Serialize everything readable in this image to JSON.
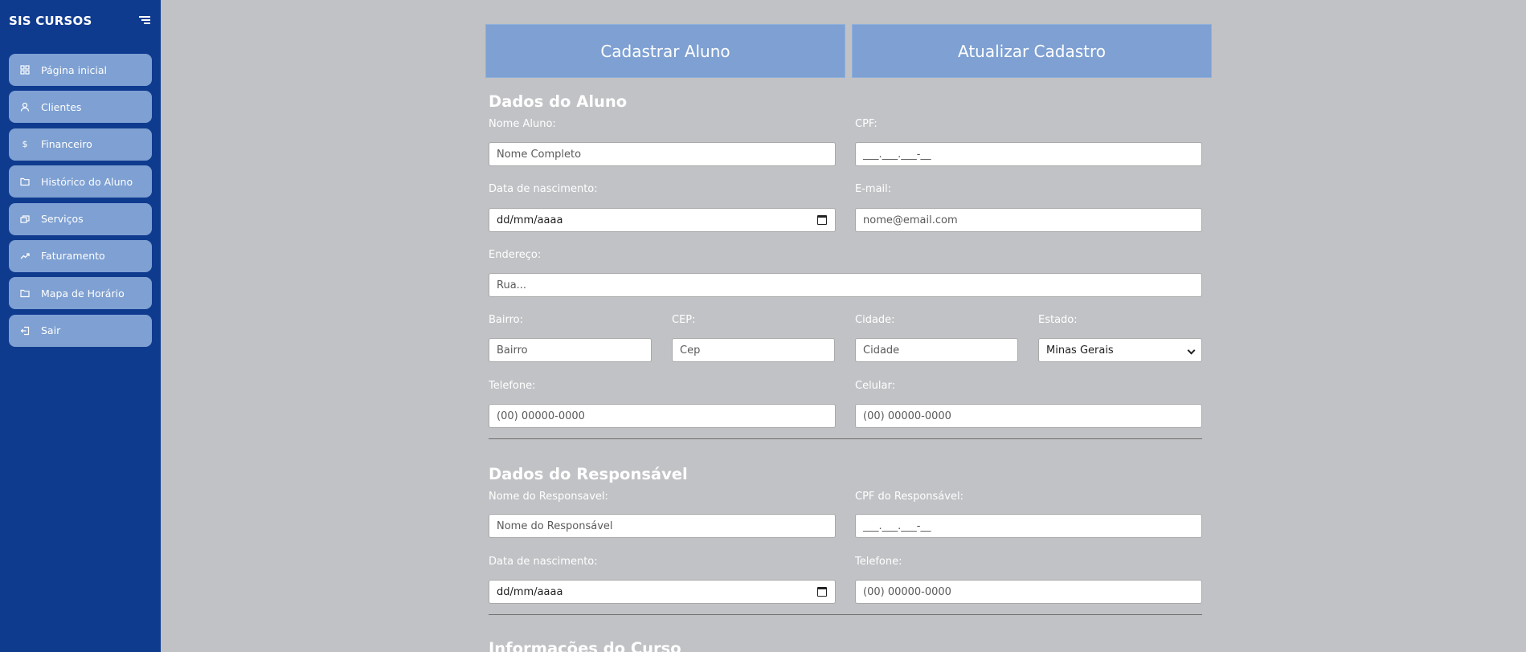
{
  "sidebar": {
    "brand": "SIS CURSOS",
    "items": [
      {
        "label": "Página inicial",
        "icon": "grid-icon"
      },
      {
        "label": "Clientes",
        "icon": "user-icon"
      },
      {
        "label": "Financeiro",
        "icon": "dollar-icon"
      },
      {
        "label": "Histórico do Aluno",
        "icon": "folder-icon"
      },
      {
        "label": "Serviços",
        "icon": "cards-icon"
      },
      {
        "label": "Faturamento",
        "icon": "trend-icon"
      },
      {
        "label": "Mapa de Horário",
        "icon": "folder-icon"
      },
      {
        "label": "Sair",
        "icon": "logout-icon"
      }
    ]
  },
  "tabs": {
    "register": "Cadastrar Aluno",
    "update": "Atualizar Cadastro"
  },
  "student": {
    "title": "Dados do Aluno",
    "name": {
      "label": "Nome Aluno:",
      "placeholder": "Nome Completo"
    },
    "cpf": {
      "label": "CPF:",
      "placeholder": "___.___.___-__"
    },
    "birth": {
      "label": "Data de nascimento:",
      "value": "dd/mm/aaaa"
    },
    "email": {
      "label": "E-mail:",
      "placeholder": "nome@email.com"
    },
    "address": {
      "label": "Endereço:",
      "placeholder": "Rua..."
    },
    "district": {
      "label": "Bairro:",
      "placeholder": "Bairro"
    },
    "cep": {
      "label": "CEP:",
      "placeholder": "Cep"
    },
    "city": {
      "label": "Cidade:",
      "placeholder": "Cidade"
    },
    "state": {
      "label": "Estado:",
      "value": "Minas Gerais"
    },
    "phone": {
      "label": "Telefone:",
      "placeholder": "(00) 00000-0000"
    },
    "mobile": {
      "label": "Celular:",
      "placeholder": "(00) 00000-0000"
    }
  },
  "guardian": {
    "title": "Dados do Responsável",
    "name": {
      "label": "Nome do Responsavel:",
      "placeholder": "Nome do Responsável"
    },
    "cpf": {
      "label": "CPF do Responsável:",
      "placeholder": "___.___.___-__"
    },
    "birth": {
      "label": "Data de nascimento:",
      "value": "dd/mm/aaaa"
    },
    "phone": {
      "label": "Telefone:",
      "placeholder": "(00) 00000-0000"
    }
  },
  "course": {
    "title": "Informações do Curso"
  }
}
